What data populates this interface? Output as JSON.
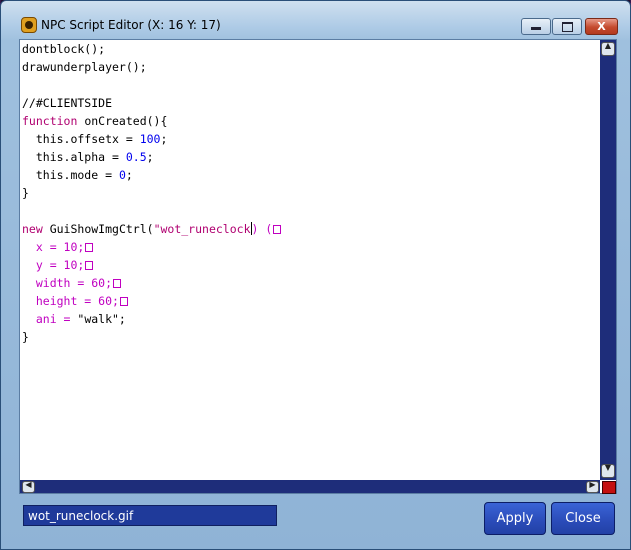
{
  "window": {
    "title": "NPC Script Editor (X: 16 Y: 17)",
    "controls": {
      "minimize": "_",
      "maximize": "□",
      "close": "X"
    }
  },
  "editor": {
    "lines": [
      {
        "parts": [
          {
            "t": "dontblock();",
            "c": ""
          }
        ]
      },
      {
        "parts": [
          {
            "t": "drawunderplayer();",
            "c": ""
          }
        ]
      },
      {
        "parts": []
      },
      {
        "parts": [
          {
            "t": "//#CLIENTSIDE",
            "c": ""
          }
        ]
      },
      {
        "parts": [
          {
            "t": "function",
            "c": "kw"
          },
          {
            "t": " onCreated(){",
            "c": ""
          }
        ]
      },
      {
        "parts": [
          {
            "t": "  this.offsetx = ",
            "c": ""
          },
          {
            "t": "100",
            "c": "num"
          },
          {
            "t": ";",
            "c": ""
          }
        ]
      },
      {
        "parts": [
          {
            "t": "  this.alpha = ",
            "c": ""
          },
          {
            "t": "0.5",
            "c": "num"
          },
          {
            "t": ";",
            "c": ""
          }
        ]
      },
      {
        "parts": [
          {
            "t": "  this.mode = ",
            "c": ""
          },
          {
            "t": "0",
            "c": "num"
          },
          {
            "t": ";",
            "c": ""
          }
        ]
      },
      {
        "parts": [
          {
            "t": "}",
            "c": ""
          }
        ]
      },
      {
        "parts": []
      },
      {
        "parts": [
          {
            "t": "new",
            "c": "kw"
          },
          {
            "t": " GuiShowImgCtrl(",
            "c": ""
          },
          {
            "t": "\"wot_runeclock",
            "c": "str"
          },
          {
            "t": "",
            "c": "caret"
          },
          {
            "t": ") (",
            "c": "pink"
          },
          {
            "t": "",
            "c": "box"
          }
        ]
      },
      {
        "parts": [
          {
            "t": "  x = 10;",
            "c": "pink"
          },
          {
            "t": "",
            "c": "box"
          }
        ]
      },
      {
        "parts": [
          {
            "t": "  y = 10;",
            "c": "pink"
          },
          {
            "t": "",
            "c": "box"
          }
        ]
      },
      {
        "parts": [
          {
            "t": "  width = 60;",
            "c": "pink"
          },
          {
            "t": "",
            "c": "box"
          }
        ]
      },
      {
        "parts": [
          {
            "t": "  height = 60;",
            "c": "pink"
          },
          {
            "t": "",
            "c": "box"
          }
        ]
      },
      {
        "parts": [
          {
            "t": "  ani = ",
            "c": "pink"
          },
          {
            "t": "\"walk\";",
            "c": ""
          }
        ]
      },
      {
        "parts": [
          {
            "t": "}",
            "c": ""
          }
        ]
      }
    ]
  },
  "footer": {
    "filename": "wot_runeclock.gif",
    "apply_label": "Apply",
    "close_label": "Close"
  },
  "colors": {
    "keyword": "#b00070",
    "number": "#0000ee",
    "string": "#c000c0",
    "button": "#2a4bb8",
    "scrollbar": "#1e2d7a"
  }
}
